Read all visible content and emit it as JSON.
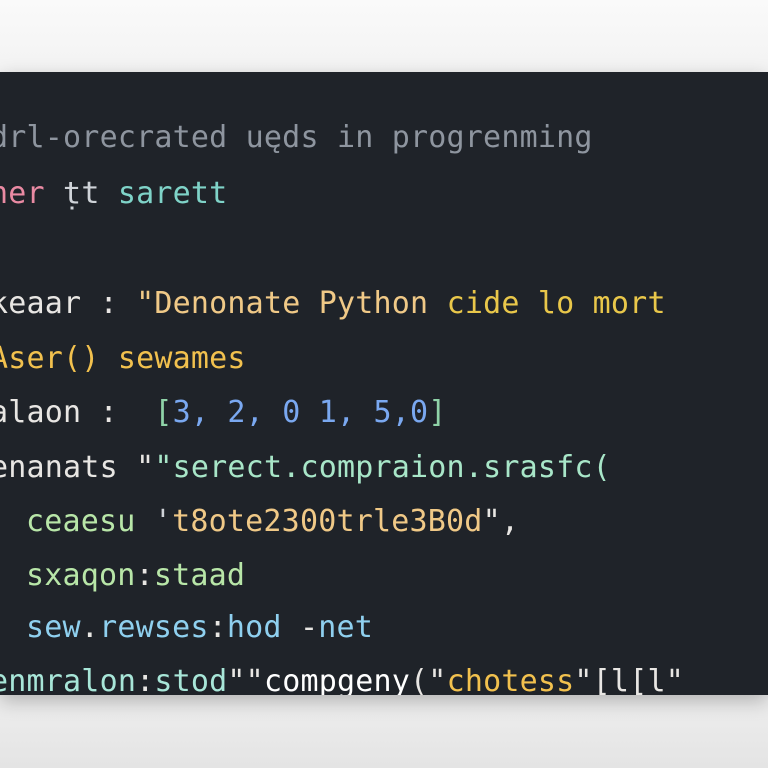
{
  "code_lines": [
    {
      "tokens": [
        {
          "text": "drl-orecrated uęds in progrenming",
          "color": "#8e959f"
        }
      ]
    },
    {
      "tokens": [
        {
          "text": "her",
          "color": "#e98aa3"
        },
        {
          "text": " ṭt ",
          "color": "#cfd3d8"
        },
        {
          "text": "sarett",
          "color": "#7fd3c8"
        }
      ]
    },
    {
      "tokens": [
        {
          "text": "keaar",
          "color": "#e8e6e3"
        },
        {
          "text": " : ",
          "color": "#e8e6e3"
        },
        {
          "text": "\"Denonate Python ",
          "color": "#f0c987"
        },
        {
          "text": "cide lo mort",
          "color": "#e9c74a"
        }
      ]
    },
    {
      "tokens": [
        {
          "text": "Aser()",
          "color": "#f2c14e"
        },
        {
          "text": " sewames",
          "color": "#f2c14e"
        }
      ]
    },
    {
      "tokens": [
        {
          "text": "alaon",
          "color": "#e8e6e3"
        },
        {
          "text": " :  ",
          "color": "#e8e6e3"
        },
        {
          "text": "[",
          "color": "#8fd3a8"
        },
        {
          "text": "3, 2, 0 1, 5,0",
          "color": "#7aa8f0"
        },
        {
          "text": "]",
          "color": "#8fd3a8"
        }
      ]
    },
    {
      "tokens": [
        {
          "text": "enanats",
          "color": "#e8e6e3"
        },
        {
          "text": " \"",
          "color": "#e8e6e3"
        },
        {
          "text": "\"serect.compraion.srasfc(",
          "color": "#a8e6c8"
        }
      ]
    },
    {
      "tokens": [
        {
          "text": "ceaesu",
          "color": "#b8e6a8"
        },
        {
          "text": " '",
          "color": "#cfd3d8"
        },
        {
          "text": "t8ote2300tr",
          "color": "#f0c987"
        },
        {
          "text": "le3B0d",
          "color": "#f0c987"
        },
        {
          "text": "\",",
          "color": "#e8e6e3"
        }
      ]
    },
    {
      "tokens": [
        {
          "text": "sxaqon",
          "color": "#b8e6a8"
        },
        {
          "text": ":",
          "color": "#e8e6e3"
        },
        {
          "text": "staad",
          "color": "#b8e6a8"
        }
      ]
    },
    {
      "tokens": [
        {
          "text": "sew",
          "color": "#8fd0ef"
        },
        {
          "text": ".",
          "color": "#e8e6e3"
        },
        {
          "text": "rewses",
          "color": "#8fd0ef"
        },
        {
          "text": ":",
          "color": "#e8e6e3"
        },
        {
          "text": "hod",
          "color": "#8fd0ef"
        },
        {
          "text": " -",
          "color": "#e8e6e3"
        },
        {
          "text": "net",
          "color": "#8fd0ef"
        }
      ]
    },
    {
      "tokens": [
        {
          "text": "enmralon",
          "color": "#a8e6d8"
        },
        {
          "text": ":",
          "color": "#e8e6e3"
        },
        {
          "text": "stod",
          "color": "#a8e6d8"
        },
        {
          "text": "\"\"",
          "color": "#e8e6e3"
        },
        {
          "text": "compgeny",
          "color": "#ffffff"
        },
        {
          "text": "(\"",
          "color": "#e8e6e3"
        },
        {
          "text": "chotess",
          "color": "#f2c14e"
        },
        {
          "text": "\"[l[l\"",
          "color": "#e8e6e3"
        }
      ]
    }
  ]
}
